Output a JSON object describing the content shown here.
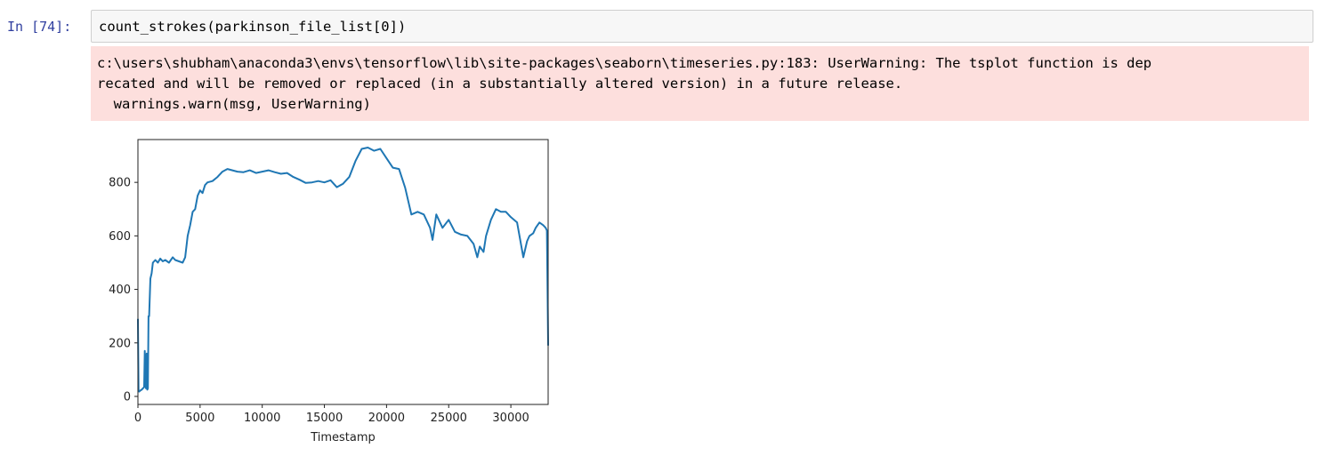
{
  "cell": {
    "prompt": "In [74]:",
    "code": "count_strokes(parkinson_file_list[0])"
  },
  "stderr": {
    "lines": [
      "c:\\users\\shubham\\anaconda3\\envs\\tensorflow\\lib\\site-packages\\seaborn\\timeseries.py:183: UserWarning: The tsplot function is dep",
      "recated and will be removed or replaced (in a substantially altered version) in a future release.",
      "  warnings.warn(msg, UserWarning)"
    ]
  },
  "colors": {
    "prompt": "#303f9f",
    "input_bg": "#f7f7f7",
    "stderr_bg": "#fddfdd",
    "line": "#1f77b4"
  },
  "chart_data": {
    "type": "line",
    "title": "",
    "xlabel": "Timestamp",
    "ylabel": "",
    "xlim": [
      0,
      33000
    ],
    "ylim": [
      -30,
      960
    ],
    "x_ticks": [
      0,
      5000,
      10000,
      15000,
      20000,
      25000,
      30000
    ],
    "y_ticks": [
      0,
      200,
      400,
      600,
      800
    ],
    "grid": false,
    "legend": "none",
    "series": [
      {
        "x": [
          0,
          50,
          100,
          150,
          200,
          300,
          400,
          500,
          550,
          600,
          650,
          700,
          750,
          800,
          850,
          900,
          1000,
          1100,
          1200,
          1400,
          1600,
          1800,
          2000,
          2200,
          2500,
          2800,
          3000,
          3300,
          3600,
          3800,
          4000,
          4200,
          4400,
          4600,
          4800,
          5000,
          5200,
          5400,
          5600,
          6000,
          6400,
          6800,
          7200,
          7600,
          8000,
          8500,
          9000,
          9500,
          10000,
          10500,
          11000,
          11500,
          12000,
          12500,
          13000,
          13500,
          14000,
          14500,
          15000,
          15500,
          16000,
          16500,
          17000,
          17500,
          18000,
          18500,
          19000,
          19500,
          20000,
          20500,
          21000,
          21500,
          22000,
          22500,
          23000,
          23500,
          23700,
          24000,
          24500,
          25000,
          25500,
          26000,
          26500,
          27000,
          27300,
          27500,
          27800,
          28000,
          28400,
          28800,
          29200,
          29600,
          30000,
          30500,
          31000,
          31300,
          31500,
          31800,
          32000,
          32300,
          32600,
          32800,
          32900,
          33000
        ],
        "values": [
          290,
          20,
          18,
          20,
          22,
          25,
          30,
          35,
          170,
          40,
          30,
          160,
          25,
          30,
          300,
          300,
          440,
          460,
          500,
          510,
          500,
          515,
          505,
          510,
          500,
          520,
          510,
          505,
          500,
          520,
          600,
          640,
          690,
          700,
          750,
          770,
          760,
          790,
          800,
          805,
          820,
          840,
          850,
          845,
          840,
          838,
          845,
          835,
          840,
          845,
          838,
          832,
          835,
          820,
          810,
          798,
          800,
          805,
          800,
          808,
          782,
          795,
          820,
          880,
          925,
          930,
          918,
          925,
          890,
          855,
          850,
          780,
          680,
          690,
          680,
          630,
          585,
          680,
          630,
          660,
          615,
          605,
          600,
          570,
          520,
          560,
          540,
          600,
          660,
          700,
          690,
          690,
          670,
          650,
          520,
          580,
          600,
          610,
          630,
          650,
          640,
          630,
          620,
          190
        ]
      }
    ]
  }
}
